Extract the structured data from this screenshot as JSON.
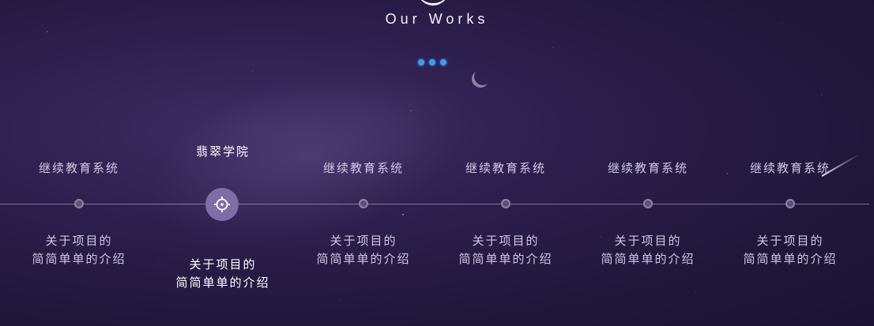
{
  "header": {
    "subtitle": "Our Works"
  },
  "pager": {
    "count": 3,
    "color": "#3f9bf0"
  },
  "timeline": {
    "active_index": 1,
    "items": [
      {
        "name": "继续教育系统",
        "desc_line1": "关于项目的",
        "desc_line2": "简简单单的介绍"
      },
      {
        "name": "翡翠学院",
        "desc_line1": "关于项目的",
        "desc_line2": "简简单单的介绍"
      },
      {
        "name": "继续教育系统",
        "desc_line1": "关于项目的",
        "desc_line2": "简简单单的介绍"
      },
      {
        "name": "继续教育系统",
        "desc_line1": "关于项目的",
        "desc_line2": "简简单单的介绍"
      },
      {
        "name": "继续教育系统",
        "desc_line1": "关于项目的",
        "desc_line2": "简简单单的介绍"
      },
      {
        "name": "继续教育系统",
        "desc_line1": "关于项目的",
        "desc_line2": "简简单单的介绍"
      }
    ]
  },
  "icons": {
    "active_node": "crosshair-icon",
    "moon": "crescent-moon-icon"
  },
  "colors": {
    "accent": "#3f9bf0",
    "active_node": "#7d6ea5",
    "background": "#2d1f4d"
  }
}
